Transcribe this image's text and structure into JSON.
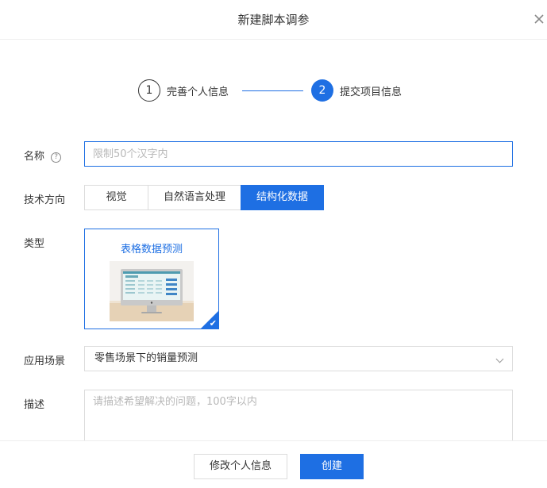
{
  "dialog": {
    "title": "新建脚本调参",
    "close_icon": "close-icon"
  },
  "steps": [
    {
      "number": "1",
      "label": "完善个人信息",
      "state": "done"
    },
    {
      "number": "2",
      "label": "提交项目信息",
      "state": "active"
    }
  ],
  "form": {
    "name": {
      "label": "名称",
      "help_icon": "question-circle-icon",
      "help_glyph": "?",
      "value": "",
      "placeholder": "限制50个汉字内"
    },
    "direction": {
      "label": "技术方向",
      "options": [
        "视觉",
        "自然语言处理",
        "结构化数据"
      ],
      "selected": "结构化数据"
    },
    "type": {
      "label": "类型",
      "card_title": "表格数据预测",
      "selected": true,
      "check_icon": "checkmark-icon",
      "check_glyph": "✔"
    },
    "scenario": {
      "label": "应用场景",
      "value": "零售场景下的销量预测",
      "chevron_icon": "chevron-down-icon"
    },
    "description": {
      "label": "描述",
      "value": "",
      "placeholder": "请描述希望解决的问题，100字以内"
    }
  },
  "footer": {
    "secondary_label": "修改个人信息",
    "primary_label": "创建"
  },
  "colors": {
    "accent": "#1e6fe3",
    "border": "#dcdcdc",
    "placeholder": "#b8b8b8"
  }
}
